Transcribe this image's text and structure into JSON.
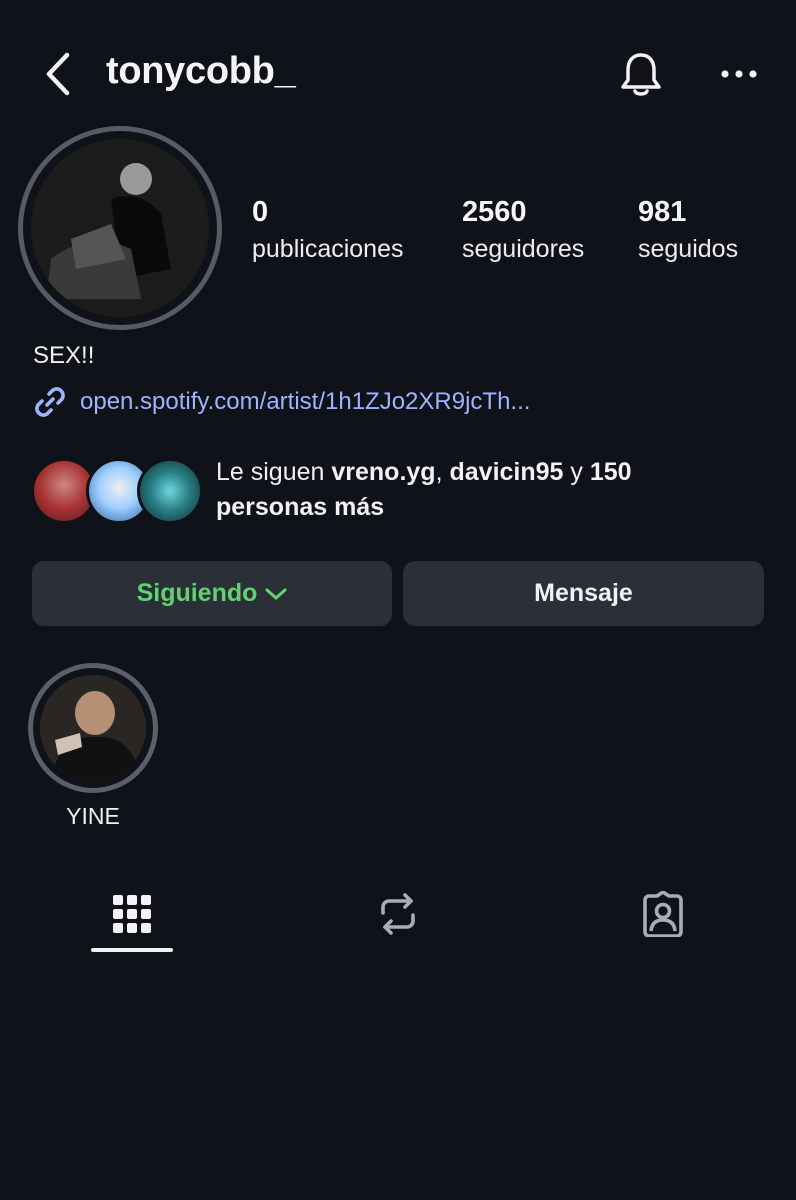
{
  "header": {
    "username": "tonycobb_",
    "back_icon": "chevron-left-icon",
    "bell_icon": "bell-icon",
    "more_icon": "more-horizontal-icon"
  },
  "profile": {
    "avatar": "profile-photo"
  },
  "stats": {
    "posts": {
      "value": "0",
      "label": "publicaciones"
    },
    "followers": {
      "value": "2560",
      "label": "seguidores"
    },
    "following": {
      "value": "981",
      "label": "seguidos"
    }
  },
  "bio": {
    "text": "SEX!!",
    "link": "open.spotify.com/artist/1h1ZJo2XR9jcTh..."
  },
  "mutual": {
    "prefix": "Le siguen ",
    "user1": "vreno.yg",
    "sep": ", ",
    "user2": "davicin95",
    "and": " y ",
    "others": "150 personas más"
  },
  "actions": {
    "following_label": "Siguiendo",
    "message_label": "Mensaje"
  },
  "highlights": [
    {
      "label": "YINE"
    }
  ],
  "tabs": {
    "grid_icon": "grid-icon",
    "reels_icon": "repost-icon",
    "tagged_icon": "tagged-person-icon"
  },
  "colors": {
    "background": "#0f1218",
    "following_green": "#62d26f",
    "link_blue": "#9fb4ff",
    "button_bg": "#2b2f37"
  }
}
